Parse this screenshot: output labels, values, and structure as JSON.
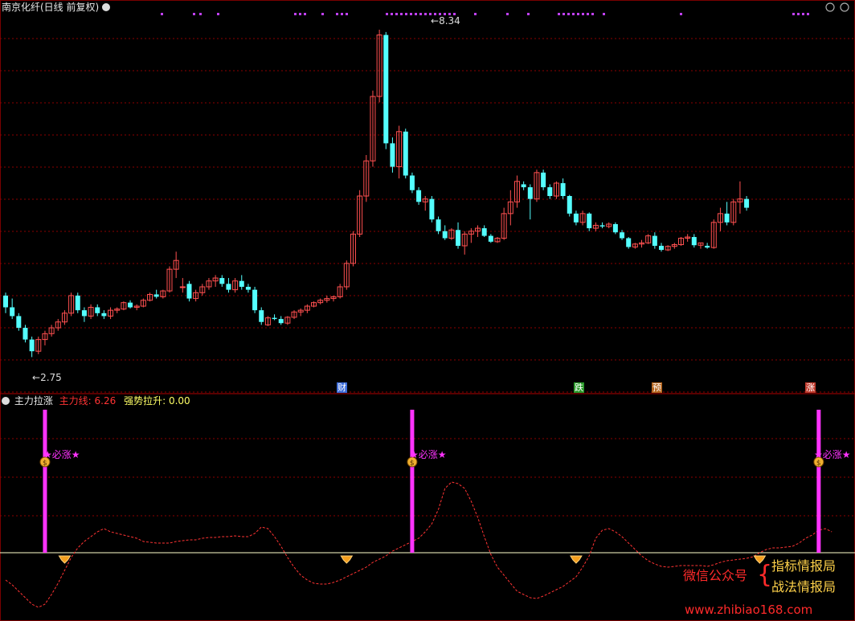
{
  "main_panel": {
    "title": "南京化纤(日线 前复权)",
    "price_high": "8.34",
    "price_low": "2.75",
    "event_marks": [
      {
        "text": "财",
        "color": "#3b6bd8"
      },
      {
        "text": "跌",
        "color": "#2a9a2a"
      },
      {
        "text": "预",
        "color": "#b5651d"
      },
      {
        "text": "涨",
        "color": "#c0392b"
      }
    ]
  },
  "indicator_panel": {
    "name": "主力拉涨",
    "line1_label": "主力线:",
    "line1_value": "6.26",
    "line2_label": "强势拉升:",
    "line2_value": "0.00",
    "signal_text": "★必涨★"
  },
  "watermark": {
    "line_a": "微信公众号",
    "line_b": "指标情报局",
    "line_c": "战法情报局",
    "url": "www.zhibiao168.com"
  },
  "colors": {
    "up": "#ff5050",
    "down": "#54ffff",
    "grid": "#8b0000",
    "signal": "#ff33ff",
    "main_line": "#ff3333",
    "zero_line": "#ffffcc"
  },
  "chart_data": {
    "type": "candlestick",
    "ylim": [
      2.4,
      8.6
    ],
    "candles": [
      [
        3.8,
        3.85,
        3.5,
        3.6
      ],
      [
        3.6,
        3.75,
        3.4,
        3.45
      ],
      [
        3.45,
        3.5,
        3.2,
        3.25
      ],
      [
        3.25,
        3.3,
        3.0,
        3.05
      ],
      [
        3.05,
        3.1,
        2.75,
        2.85
      ],
      [
        2.85,
        3.1,
        2.8,
        3.05
      ],
      [
        3.05,
        3.2,
        2.95,
        3.15
      ],
      [
        3.15,
        3.3,
        3.1,
        3.25
      ],
      [
        3.25,
        3.4,
        3.2,
        3.35
      ],
      [
        3.35,
        3.55,
        3.3,
        3.5
      ],
      [
        3.5,
        3.85,
        3.45,
        3.8
      ],
      [
        3.8,
        3.85,
        3.5,
        3.55
      ],
      [
        3.55,
        3.6,
        3.35,
        3.45
      ],
      [
        3.45,
        3.65,
        3.4,
        3.6
      ],
      [
        3.6,
        3.65,
        3.45,
        3.5
      ],
      [
        3.5,
        3.55,
        3.4,
        3.45
      ],
      [
        3.45,
        3.6,
        3.4,
        3.55
      ],
      [
        3.55,
        3.6,
        3.5,
        3.57
      ],
      [
        3.57,
        3.7,
        3.55,
        3.68
      ],
      [
        3.68,
        3.72,
        3.58,
        3.6
      ],
      [
        3.6,
        3.65,
        3.55,
        3.62
      ],
      [
        3.62,
        3.75,
        3.6,
        3.72
      ],
      [
        3.72,
        3.85,
        3.7,
        3.82
      ],
      [
        3.82,
        3.9,
        3.75,
        3.78
      ],
      [
        3.78,
        3.9,
        3.75,
        3.88
      ],
      [
        3.88,
        4.3,
        3.85,
        4.25
      ],
      [
        4.25,
        4.55,
        4.1,
        4.4
      ],
      [
        3.95,
        4.1,
        3.85,
        3.95
      ],
      [
        4.0,
        4.05,
        3.7,
        3.75
      ],
      [
        3.75,
        3.9,
        3.7,
        3.85
      ],
      [
        3.85,
        4.0,
        3.8,
        3.95
      ],
      [
        3.95,
        4.1,
        3.9,
        4.05
      ],
      [
        4.05,
        4.15,
        3.95,
        4.1
      ],
      [
        4.1,
        4.15,
        3.95,
        4.0
      ],
      [
        4.0,
        4.1,
        3.85,
        3.9
      ],
      [
        3.9,
        4.1,
        3.85,
        4.05
      ],
      [
        4.05,
        4.15,
        3.9,
        3.95
      ],
      [
        3.95,
        4.0,
        3.85,
        3.9
      ],
      [
        3.9,
        3.95,
        3.5,
        3.55
      ],
      [
        3.55,
        3.6,
        3.3,
        3.35
      ],
      [
        3.3,
        3.45,
        3.28,
        3.42
      ],
      [
        3.42,
        3.48,
        3.38,
        3.4
      ],
      [
        3.4,
        3.45,
        3.3,
        3.33
      ],
      [
        3.33,
        3.45,
        3.3,
        3.43
      ],
      [
        3.43,
        3.55,
        3.4,
        3.52
      ],
      [
        3.52,
        3.58,
        3.45,
        3.55
      ],
      [
        3.55,
        3.65,
        3.5,
        3.62
      ],
      [
        3.62,
        3.7,
        3.6,
        3.68
      ],
      [
        3.68,
        3.75,
        3.65,
        3.72
      ],
      [
        3.72,
        3.8,
        3.68,
        3.75
      ],
      [
        3.75,
        3.8,
        3.7,
        3.78
      ],
      [
        3.78,
        4.0,
        3.75,
        3.95
      ],
      [
        3.95,
        4.4,
        3.9,
        4.35
      ],
      [
        4.35,
        4.9,
        4.3,
        4.85
      ],
      [
        4.85,
        5.6,
        4.8,
        5.5
      ],
      [
        5.5,
        6.2,
        5.4,
        6.1
      ],
      [
        6.1,
        7.3,
        6.0,
        7.2
      ],
      [
        7.2,
        8.34,
        7.1,
        8.25
      ],
      [
        8.25,
        8.3,
        6.3,
        6.4
      ],
      [
        6.4,
        6.5,
        5.9,
        6.0
      ],
      [
        6.0,
        6.7,
        5.8,
        6.6
      ],
      [
        6.6,
        6.65,
        5.8,
        5.85
      ],
      [
        5.85,
        5.9,
        5.55,
        5.6
      ],
      [
        5.6,
        5.65,
        5.35,
        5.4
      ],
      [
        5.4,
        5.5,
        5.25,
        5.45
      ],
      [
        5.45,
        5.5,
        5.05,
        5.1
      ],
      [
        5.1,
        5.15,
        4.85,
        4.9
      ],
      [
        4.9,
        5.0,
        4.75,
        4.78
      ],
      [
        4.78,
        4.95,
        4.75,
        4.92
      ],
      [
        4.92,
        5.05,
        4.6,
        4.65
      ],
      [
        4.65,
        4.9,
        4.5,
        4.85
      ],
      [
        4.85,
        4.95,
        4.7,
        4.9
      ],
      [
        4.9,
        5.0,
        4.8,
        4.95
      ],
      [
        4.95,
        5.0,
        4.8,
        4.82
      ],
      [
        4.82,
        4.85,
        4.7,
        4.72
      ],
      [
        4.72,
        4.8,
        4.7,
        4.78
      ],
      [
        4.78,
        5.3,
        4.75,
        5.2
      ],
      [
        5.2,
        5.6,
        5.0,
        5.4
      ],
      [
        5.4,
        5.85,
        5.3,
        5.75
      ],
      [
        5.7,
        5.75,
        5.6,
        5.65
      ],
      [
        5.65,
        5.7,
        5.1,
        5.45
      ],
      [
        5.45,
        5.95,
        5.4,
        5.9
      ],
      [
        5.9,
        5.95,
        5.6,
        5.65
      ],
      [
        5.65,
        5.7,
        5.45,
        5.5
      ],
      [
        5.5,
        5.75,
        5.45,
        5.72
      ],
      [
        5.72,
        5.8,
        5.45,
        5.5
      ],
      [
        5.5,
        5.52,
        5.15,
        5.2
      ],
      [
        5.2,
        5.25,
        5.0,
        5.05
      ],
      [
        5.05,
        5.25,
        5.0,
        5.2
      ],
      [
        5.2,
        5.22,
        4.9,
        4.95
      ],
      [
        4.95,
        5.05,
        4.9,
        5.0
      ],
      [
        5.0,
        5.05,
        4.95,
        4.98
      ],
      [
        4.98,
        5.05,
        4.95,
        5.02
      ],
      [
        5.02,
        5.05,
        4.85,
        4.88
      ],
      [
        4.88,
        4.92,
        4.75,
        4.78
      ],
      [
        4.78,
        4.8,
        4.6,
        4.63
      ],
      [
        4.63,
        4.7,
        4.6,
        4.68
      ],
      [
        4.68,
        4.75,
        4.62,
        4.7
      ],
      [
        4.7,
        4.85,
        4.68,
        4.82
      ],
      [
        4.82,
        4.88,
        4.6,
        4.65
      ],
      [
        4.65,
        4.7,
        4.55,
        4.58
      ],
      [
        4.58,
        4.66,
        4.56,
        4.64
      ],
      [
        4.64,
        4.7,
        4.6,
        4.67
      ],
      [
        4.67,
        4.8,
        4.65,
        4.78
      ],
      [
        4.78,
        4.85,
        4.72,
        4.8
      ],
      [
        4.8,
        4.85,
        4.62,
        4.66
      ],
      [
        4.66,
        4.7,
        4.6,
        4.7
      ],
      [
        4.65,
        4.7,
        4.6,
        4.62
      ],
      [
        4.62,
        5.1,
        4.6,
        5.05
      ],
      [
        5.05,
        5.3,
        4.9,
        5.2
      ],
      [
        5.2,
        5.4,
        5.0,
        5.05
      ],
      [
        5.05,
        5.45,
        5.0,
        5.4
      ],
      [
        5.4,
        5.75,
        5.2,
        5.45
      ],
      [
        5.45,
        5.5,
        5.25,
        5.3
      ]
    ],
    "annotations": [
      "8.34",
      "2.75"
    ]
  },
  "indicator_data": {
    "type": "line",
    "signal_bars_at": [
      6,
      62,
      124
    ],
    "diamond_marks_at": [
      9,
      52,
      87,
      115
    ],
    "line": [
      -1.7,
      -2.0,
      -2.4,
      -2.8,
      -3.2,
      -3.4,
      -3.2,
      -2.6,
      -1.9,
      -1.1,
      -0.3,
      0.3,
      0.7,
      1.0,
      1.3,
      1.5,
      1.3,
      1.2,
      1.1,
      1.0,
      0.9,
      0.7,
      0.65,
      0.6,
      0.6,
      0.6,
      0.7,
      0.75,
      0.8,
      0.8,
      0.9,
      0.95,
      0.95,
      1.0,
      1.0,
      1.05,
      1.0,
      1.0,
      1.2,
      1.6,
      1.5,
      1.0,
      0.4,
      -0.3,
      -0.9,
      -1.4,
      -1.7,
      -1.9,
      -1.95,
      -1.95,
      -1.85,
      -1.7,
      -1.5,
      -1.3,
      -1.1,
      -0.9,
      -0.6,
      -0.4,
      -0.2,
      0.1,
      0.3,
      0.5,
      0.7,
      0.9,
      1.3,
      1.8,
      2.7,
      4.0,
      4.4,
      4.3,
      4.0,
      3.2,
      2.2,
      1.0,
      -0.1,
      -0.9,
      -1.4,
      -1.9,
      -2.4,
      -2.6,
      -2.8,
      -2.85,
      -2.7,
      -2.5,
      -2.3,
      -2.1,
      -1.8,
      -1.5,
      -0.9,
      -0.2,
      0.9,
      1.4,
      1.5,
      1.3,
      1.0,
      0.6,
      0.2,
      -0.2,
      -0.5,
      -0.7,
      -0.85,
      -0.9,
      -0.85,
      -0.8,
      -0.8,
      -0.8,
      -0.8,
      -0.85,
      -0.75,
      -0.6,
      -0.5,
      -0.45,
      -0.4,
      -0.35,
      -0.25,
      0.0,
      0.2,
      0.3,
      0.3,
      0.35,
      0.4,
      0.6,
      0.9,
      1.1,
      1.4,
      1.5,
      1.3
    ]
  }
}
